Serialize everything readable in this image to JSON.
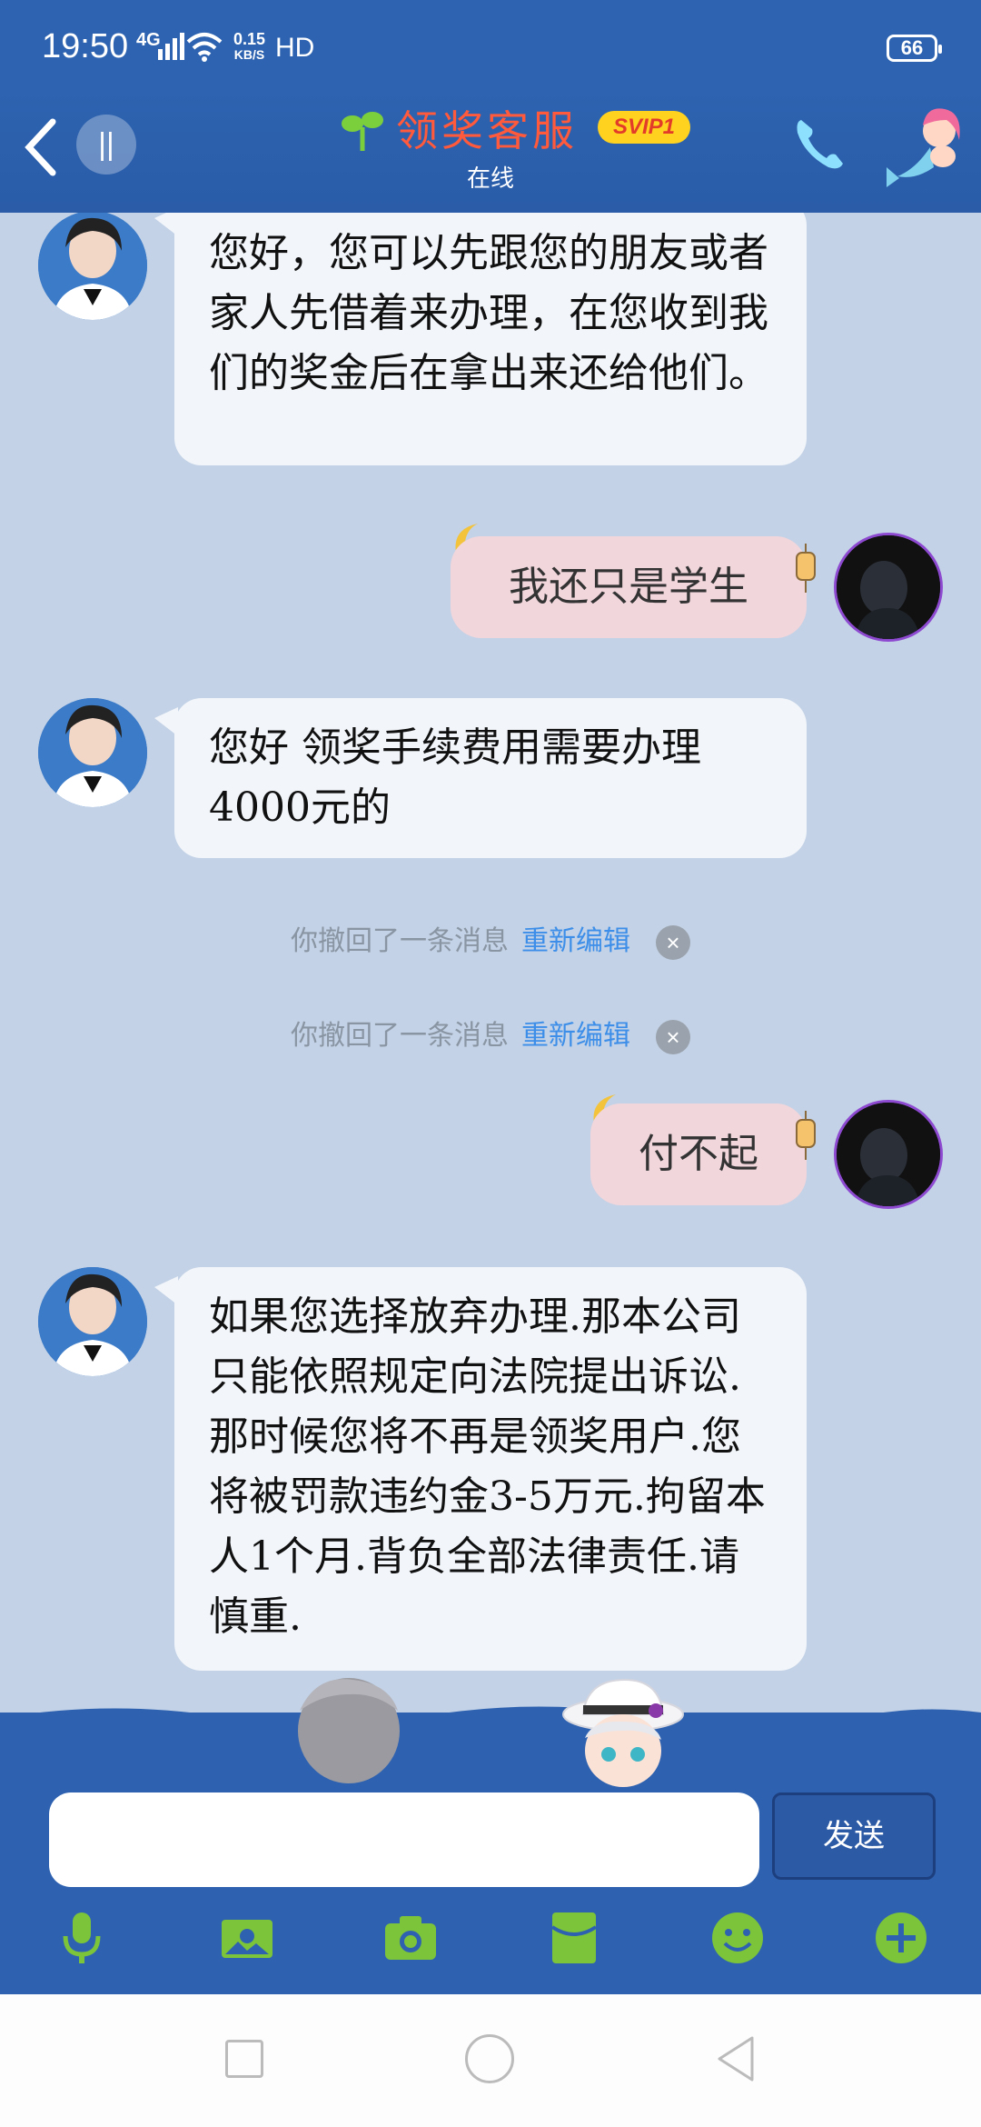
{
  "status_bar": {
    "time": "19:50",
    "network": "4G",
    "speed_value": "0.15",
    "speed_unit": "KB/S",
    "hd": "HD",
    "battery": "66"
  },
  "header": {
    "title": "领奖客服",
    "badge": "SVIP1",
    "status": "在线",
    "back_icon": "chevron-left-icon",
    "phone_icon": "phone-icon"
  },
  "messages": [
    {
      "from": "agent",
      "text": "您好，您可以先跟您的朋友或者家人先借着来办理，在您收到我们的奖金后在拿出来还给他们。"
    },
    {
      "from": "me",
      "text": "我还只是学生"
    },
    {
      "from": "agent",
      "text": "您好 领奖手续费用需要办理4000元的"
    },
    {
      "from": "system",
      "text": "你撤回了一条消息",
      "action": "重新编辑"
    },
    {
      "from": "system",
      "text": "你撤回了一条消息",
      "action": "重新编辑"
    },
    {
      "from": "me",
      "text": "付不起"
    },
    {
      "from": "agent",
      "text": "如果您选择放弃办理.那本公司只能依照规定向法院提出诉讼.那时候您将不再是领奖用户.您将被罚款违约金3-5万元.拘留本人1个月.背负全部法律责任.请慎重."
    }
  ],
  "compose": {
    "input_value": "",
    "send_label": "发送"
  },
  "toolbar": [
    "microphone-icon",
    "image-icon",
    "camera-icon",
    "red-packet-icon",
    "emoji-icon",
    "plus-icon"
  ],
  "colors": {
    "header_bg": "#2d63b0",
    "chat_bg": "#c3d2e6",
    "incoming_bubble": "#f2f5fa",
    "outgoing_bubble": "#f1d6dc",
    "title_red": "#ff5a3c",
    "badge_yellow": "#ffd21f",
    "link_blue": "#3c8ee8",
    "toolbar_green": "#7cc43a"
  }
}
